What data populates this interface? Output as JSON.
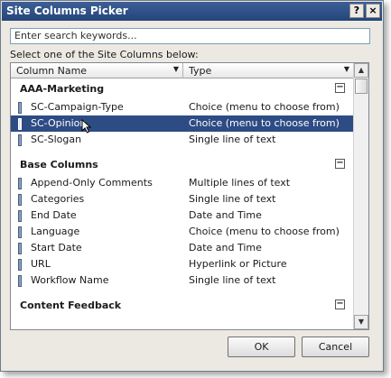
{
  "window": {
    "title": "Site Columns Picker",
    "help_label": "?",
    "close_label": "×"
  },
  "search": {
    "placeholder": "Enter search keywords..."
  },
  "instruction": "Select one of the Site Columns below:",
  "columns": {
    "name_header": "Column Name",
    "type_header": "Type"
  },
  "groups": [
    {
      "name": "AAA-Marketing",
      "items": [
        {
          "name": "SC-Campaign-Type",
          "type": "Choice (menu to choose from)"
        },
        {
          "name": "SC-Opinion",
          "type": "Choice (menu to choose from)",
          "selected": true
        },
        {
          "name": "SC-Slogan",
          "type": "Single line of text"
        }
      ]
    },
    {
      "name": "Base Columns",
      "items": [
        {
          "name": "Append-Only Comments",
          "type": "Multiple lines of text"
        },
        {
          "name": "Categories",
          "type": "Single line of text"
        },
        {
          "name": "End Date",
          "type": "Date and Time"
        },
        {
          "name": "Language",
          "type": "Choice (menu to choose from)"
        },
        {
          "name": "Start Date",
          "type": "Date and Time"
        },
        {
          "name": "URL",
          "type": "Hyperlink or Picture"
        },
        {
          "name": "Workflow Name",
          "type": "Single line of text"
        }
      ]
    },
    {
      "name": "Content Feedback",
      "items": []
    }
  ],
  "buttons": {
    "ok": "OK",
    "cancel": "Cancel"
  },
  "colors": {
    "title_bar": "#23457a",
    "selection": "#2d4c84",
    "dialog_bg": "#ece9e2"
  }
}
